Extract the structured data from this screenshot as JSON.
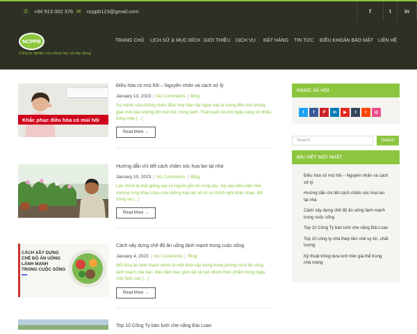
{
  "topbar": {
    "phone": "+84 913 002 376",
    "email": "ncppb123@gmail.com",
    "social": [
      {
        "icon": "facebook-icon",
        "glyph": "f"
      },
      {
        "icon": "twitter-icon",
        "glyph": "t"
      },
      {
        "icon": "linkedin-icon",
        "glyph": "in"
      }
    ]
  },
  "header": {
    "logo_text": "NCPPB",
    "tagline": "Công ty nghiên cứu khoa học và xây dựng",
    "nav": [
      "TRANG CHỦ",
      "LỊCH SỬ & MỤC ĐÍCH",
      "GIỚI THIỆU",
      "DỊCH VỤ",
      "ĐẶT HÀNG",
      "TIN TỨC",
      "ĐIỀU KHOẢN BẢO MẬT",
      "LIÊN HỆ"
    ]
  },
  "posts": [
    {
      "title": "Điều hòa có mùi hôi – Nguyên nhân và cách xử lý",
      "date": "January 13, 2023",
      "comments": "No Comments",
      "category": "Blog",
      "excerpt": "Sứ mệnh của những chiếc điều hòa hiện đại ngày nay là mang đến cho không gian một bầu không khí mát mẻ, trong lành. Thật tuyệt vời khi ngày càng có nhiều dòng máy […]",
      "read_more": "Read More →",
      "thumb_text": "Khắc phục điều hòa có mùi hôi"
    },
    {
      "title": "Hướng dẫn chi tiết cách chăm sóc hoa lan tại nhà",
      "date": "January 10, 2023",
      "comments": "No Comments",
      "category": "Blog",
      "excerpt": "Lan chính là một giống cây có nguồn gốc từ rừng sâu, tùy vào điều kiện môi trường rừng khác nhau mà những loại lan sẽ có sự thích nghi khác nhau. Để trồng và […]",
      "read_more": "Read More →",
      "thumb_text": ""
    },
    {
      "title": "Cách xây dựng chế độ ăn uống lành mạnh trong cuộc sống",
      "date": "January 4, 2023",
      "comments": "No Comments",
      "category": "Blog",
      "excerpt": "Mỗi bữa ăn lành mạnh chính là một khởi xây dựng trong phong cách ăn uống lành mạnh của bạn. Bảo đảm bao gồm tất cả các nhóm thực phẩm trong ngày. Hãy biến các […]",
      "read_more": "Read More →",
      "thumb_text": "CÁCH XÂY DỰNG CHẾ ĐỘ ĂN UỐNG LÀNH MẠNH TRONG CUỘC SỐNG"
    },
    {
      "title": "Top 10 Công Ty bán lưới che nắng Đài Loan"
    }
  ],
  "sidebar": {
    "social_heading": "MẠNG XÃ HỘI",
    "share_buttons": [
      {
        "icon": "twitter-icon",
        "glyph": "t",
        "color": "#1da1f2"
      },
      {
        "icon": "facebook-icon",
        "glyph": "f",
        "color": "#3b5998"
      },
      {
        "icon": "pinterest-icon",
        "glyph": "P",
        "color": "#cb2027"
      },
      {
        "icon": "linkedin-icon",
        "glyph": "in",
        "color": "#0077b5"
      },
      {
        "icon": "youtube-icon",
        "glyph": "▶",
        "color": "#e02a20"
      },
      {
        "icon": "tumblr-icon",
        "glyph": "t",
        "color": "#35465c"
      },
      {
        "icon": "reddit-icon",
        "glyph": "r",
        "color": "#ff4500"
      },
      {
        "icon": "dribbble-icon",
        "glyph": "◎",
        "color": "#ea4c89"
      }
    ],
    "search_placeholder": "Search...",
    "search_button": "Search",
    "recent_heading": "BÀI VIẾT MỚI NHẤT",
    "recent_posts": [
      "Điều hòa có mùi hôi – Nguyên nhân và cách xử lý",
      "Hướng dẫn chi tiết cách chăm sóc hoa lan tại nhà",
      "Cách xây dựng chế độ ăn uống lành mạnh trong cuộc sống",
      "Top 10 Công Ty bán lưới che nắng Đài Loan",
      "Top 10 công ty nhà thép tiền chế uy tín, chất lượng",
      "Kỹ thuật trồng dưa lưới trên giá thể trong nhà màng"
    ]
  },
  "colors": {
    "accent": "#8cc63f",
    "dark": "#2f3024"
  }
}
